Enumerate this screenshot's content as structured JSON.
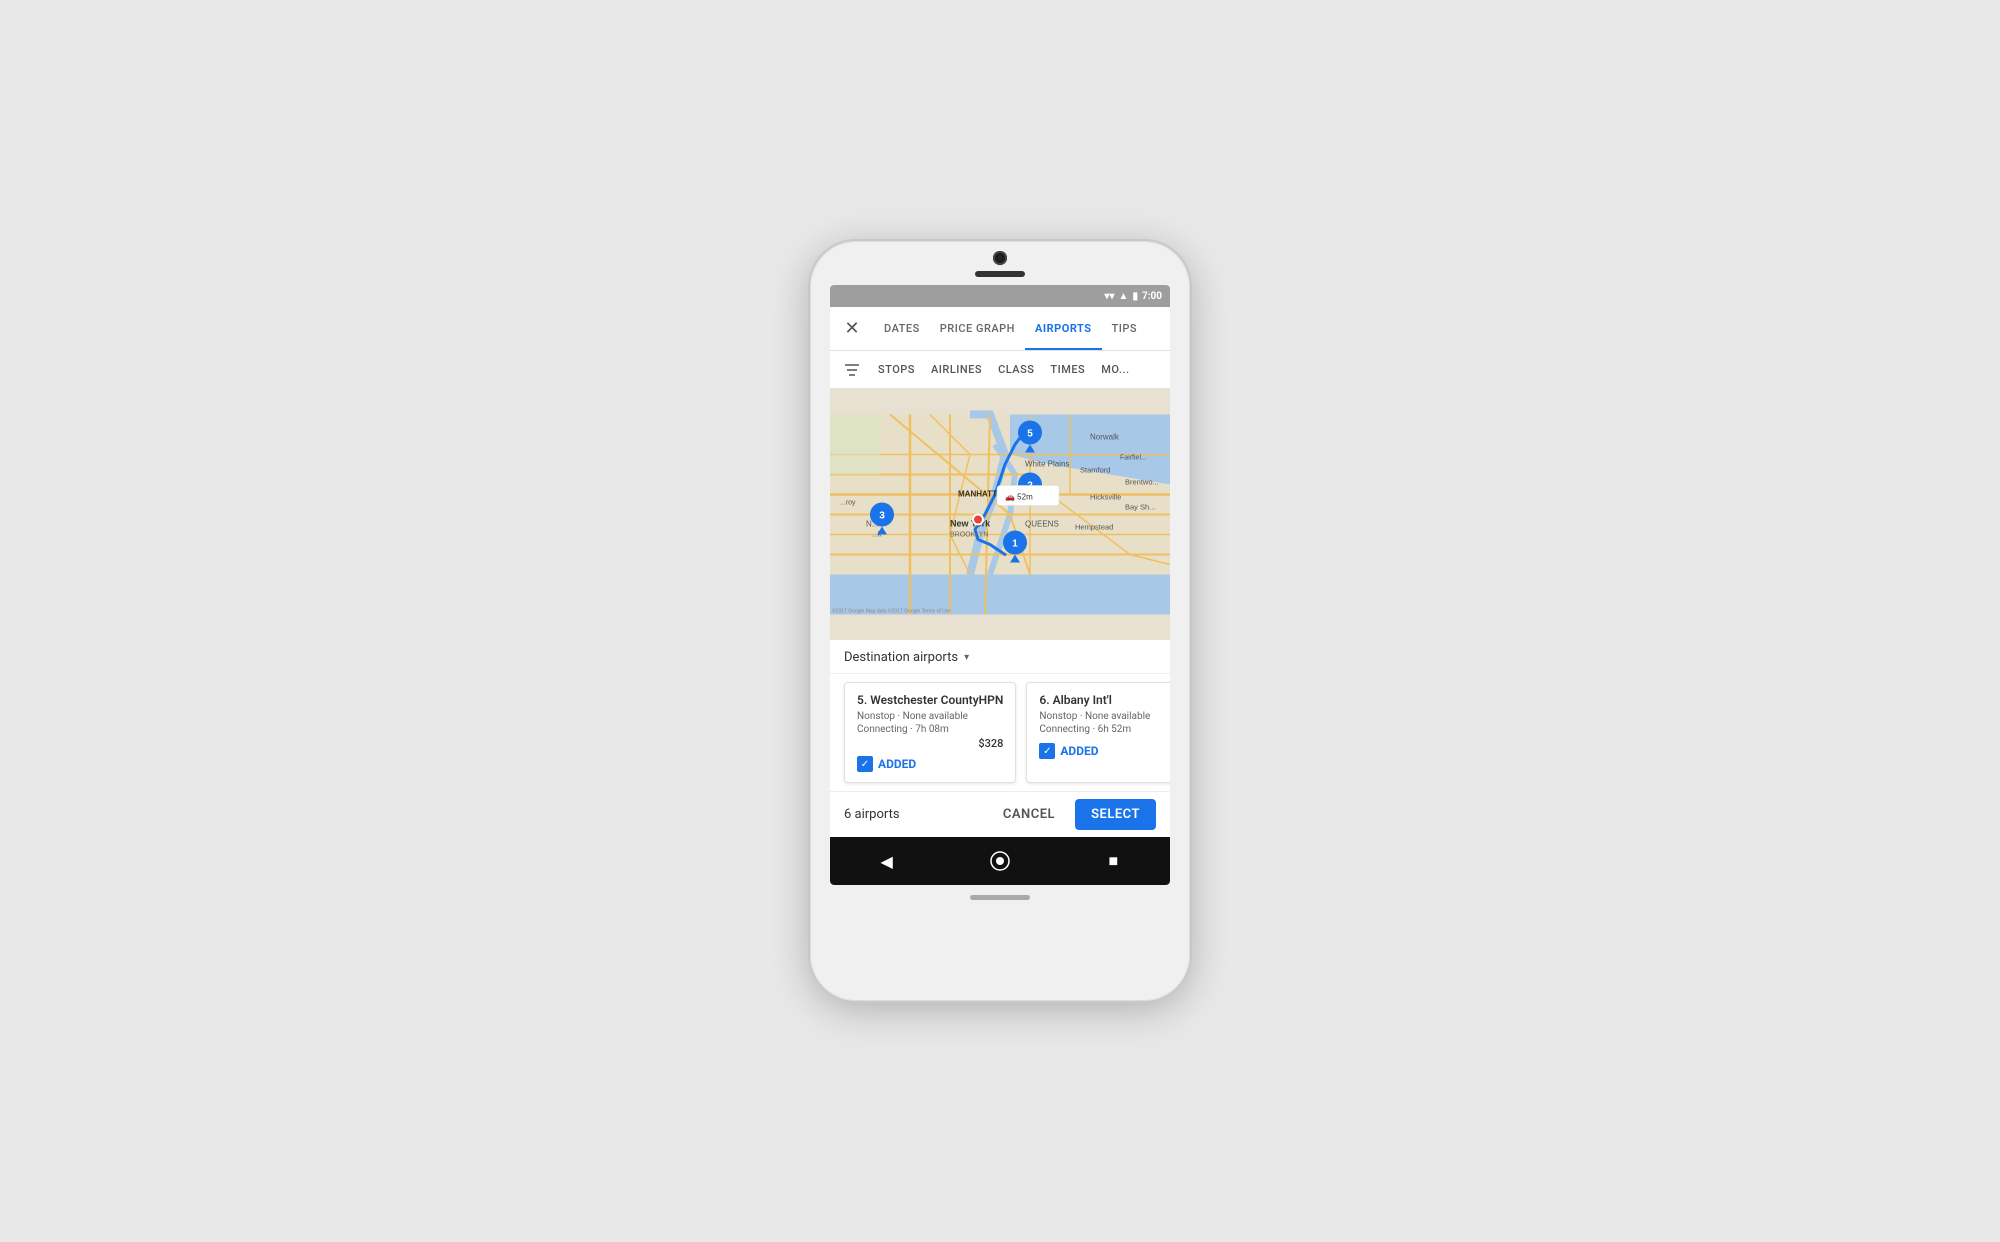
{
  "phone": {
    "status_bar": {
      "time": "7:00"
    },
    "nav_tabs": [
      {
        "id": "dates",
        "label": "DATES",
        "active": false
      },
      {
        "id": "price-graph",
        "label": "PRICE GRAPH",
        "active": false
      },
      {
        "id": "airports",
        "label": "AIRPORTS",
        "active": true
      },
      {
        "id": "tips",
        "label": "TIPS",
        "active": false
      }
    ],
    "filter_tabs": [
      {
        "id": "stops",
        "label": "STOPS"
      },
      {
        "id": "airlines",
        "label": "AIRLINES"
      },
      {
        "id": "class",
        "label": "CLASS"
      },
      {
        "id": "times",
        "label": "TIMES"
      },
      {
        "id": "more",
        "label": "MO..."
      }
    ],
    "map": {
      "drive_time": "52m",
      "pins": [
        {
          "number": "1",
          "color": "blue"
        },
        {
          "number": "2",
          "color": "blue"
        },
        {
          "number": "3",
          "color": "blue"
        },
        {
          "number": "5",
          "color": "blue"
        }
      ]
    },
    "destination_section": {
      "label": "Destination airports",
      "airports": [
        {
          "number": "5",
          "name": "Westchester County",
          "code": "HPN",
          "nonstop_label": "Nonstop · None available",
          "connecting_label": "Connecting · 7h 08m",
          "price": "$328",
          "status": "ADDED",
          "added": true
        },
        {
          "number": "6",
          "name": "Albany Int'l",
          "code": "",
          "nonstop_label": "Nonstop · None available",
          "connecting_label": "Connecting · 6h 52m",
          "price": "",
          "status": "ADDED",
          "added": true
        }
      ]
    },
    "action_bar": {
      "count_label": "6 airports",
      "cancel_label": "CANCEL",
      "select_label": "SELECT"
    },
    "bottom_nav": {
      "back": "◀",
      "home": "⬤",
      "square": "■"
    }
  }
}
